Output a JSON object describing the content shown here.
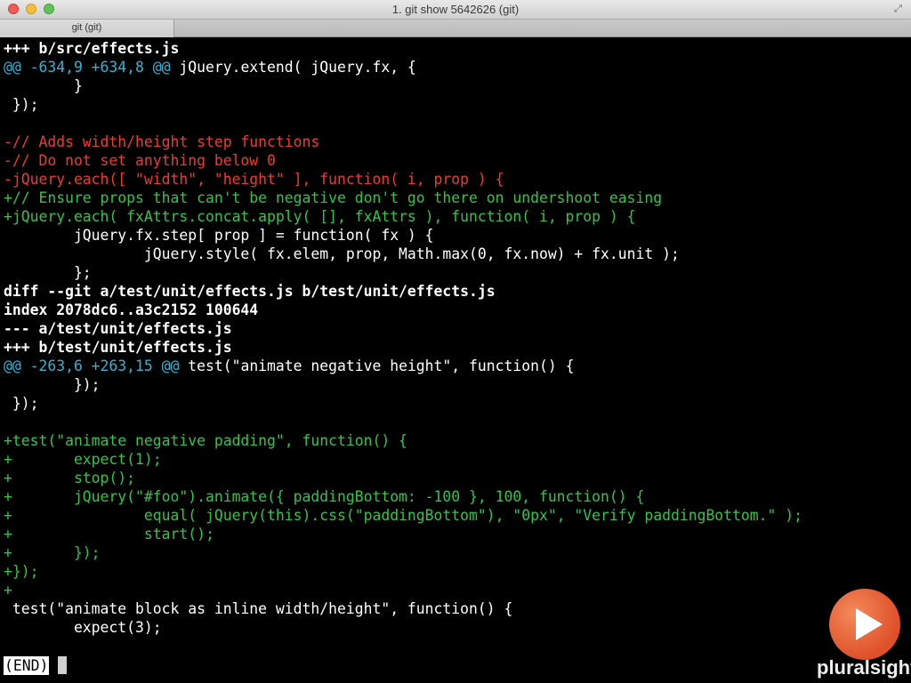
{
  "window": {
    "title": "1. git show 5642626 (git)",
    "tab_label": "git (git)"
  },
  "terminal": {
    "lines": [
      {
        "text": "+++ b/src/effects.js",
        "color": "white"
      },
      {
        "prefix": "@@ -634,9 +634,8 @@",
        "text": " jQuery.extend( jQuery.fx, {",
        "prefix_color": "cyan",
        "color": "plain"
      },
      {
        "text": "        }",
        "color": "plain"
      },
      {
        "text": " });",
        "color": "plain"
      },
      {
        "text": " ",
        "color": "plain"
      },
      {
        "text": "-// Adds width/height step functions",
        "color": "red"
      },
      {
        "text": "-// Do not set anything below 0",
        "color": "red"
      },
      {
        "text": "-jQuery.each([ \"width\", \"height\" ], function( i, prop ) {",
        "color": "red"
      },
      {
        "text": "+// Ensure props that can't be negative don't go there on undershoot easing",
        "color": "green"
      },
      {
        "text": "+jQuery.each( fxAttrs.concat.apply( [], fxAttrs ), function( i, prop ) {",
        "color": "green"
      },
      {
        "text": "        jQuery.fx.step[ prop ] = function( fx ) {",
        "color": "plain"
      },
      {
        "text": "                jQuery.style( fx.elem, prop, Math.max(0, fx.now) + fx.unit );",
        "color": "plain"
      },
      {
        "text": "        };",
        "color": "plain"
      },
      {
        "text": "diff --git a/test/unit/effects.js b/test/unit/effects.js",
        "color": "white"
      },
      {
        "text": "index 2078dc6..a3c2152 100644",
        "color": "white"
      },
      {
        "text": "--- a/test/unit/effects.js",
        "color": "white"
      },
      {
        "text": "+++ b/test/unit/effects.js",
        "color": "white"
      },
      {
        "prefix": "@@ -263,6 +263,15 @@",
        "text": " test(\"animate negative height\", function() {",
        "prefix_color": "cyan",
        "color": "plain"
      },
      {
        "text": "        });",
        "color": "plain"
      },
      {
        "text": " });",
        "color": "plain"
      },
      {
        "text": " ",
        "color": "plain"
      },
      {
        "text": "+test(\"animate negative padding\", function() {",
        "color": "green"
      },
      {
        "text": "+       expect(1);",
        "color": "green"
      },
      {
        "text": "+       stop();",
        "color": "green"
      },
      {
        "text": "+       jQuery(\"#foo\").animate({ paddingBottom: -100 }, 100, function() {",
        "color": "green"
      },
      {
        "text": "+               equal( jQuery(this).css(\"paddingBottom\"), \"0px\", \"Verify paddingBottom.\" );",
        "color": "green"
      },
      {
        "text": "+               start();",
        "color": "green"
      },
      {
        "text": "+       });",
        "color": "green"
      },
      {
        "text": "+});",
        "color": "green"
      },
      {
        "text": "+",
        "color": "green"
      },
      {
        "text": " test(\"animate block as inline width/height\", function() {",
        "color": "plain"
      },
      {
        "text": "        expect(3);",
        "color": "plain"
      }
    ],
    "pager_prompt": "(END)"
  },
  "watermark": {
    "brand_text": "pluralsight",
    "icon": "play-icon",
    "color": "#de4f2a"
  },
  "colors": {
    "background": "#000000",
    "added": "#35c34a",
    "removed": "#ee3b33",
    "hunk_header": "#33b4d6"
  }
}
